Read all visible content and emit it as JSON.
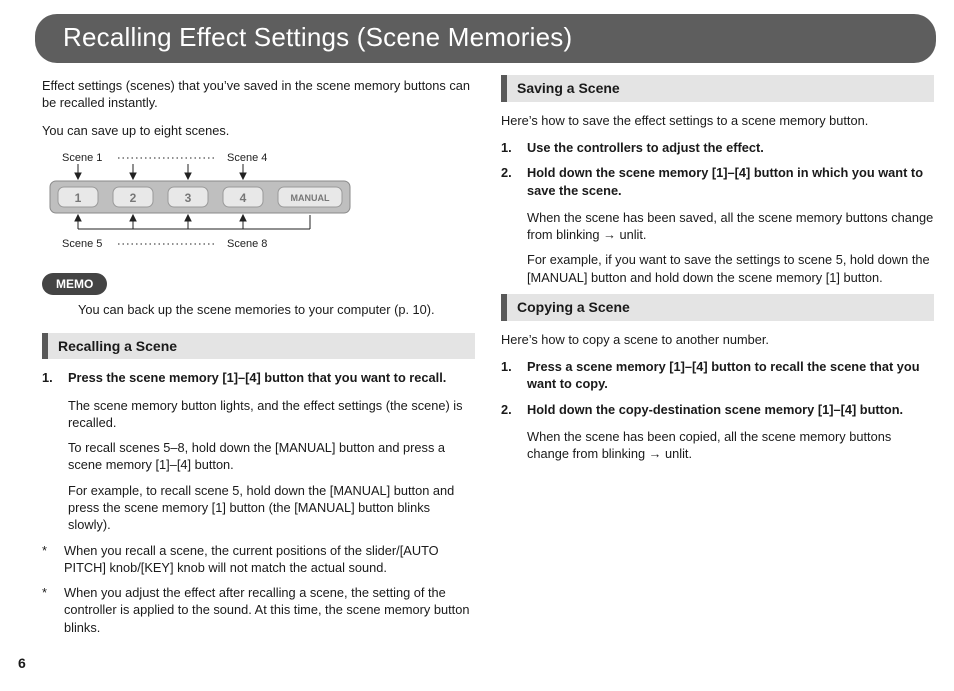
{
  "title": "Recalling Effect Settings (Scene Memories)",
  "page_number": "6",
  "left": {
    "intro1": "Effect settings (scenes) that you’ve saved in the scene memory buttons can be recalled instantly.",
    "intro2": "You can save up to eight scenes.",
    "diagram": {
      "scene1": "Scene 1",
      "scene4": "Scene 4",
      "scene5": "Scene 5",
      "scene8": "Scene 8",
      "btn1": "1",
      "btn2": "2",
      "btn3": "3",
      "btn4": "4",
      "manual": "MANUAL"
    },
    "memo_label": "MEMO",
    "memo_text": "You can back up the scene memories to your computer (p. 10).",
    "recall_head": "Recalling a Scene",
    "recall_step1": "Press the scene memory [1]–[4] button that you want to recall.",
    "recall_sub1": "The scene memory button lights, and the effect settings (the scene) is recalled.",
    "recall_sub2": "To recall scenes 5–8, hold down the [MANUAL] button and press a scene memory [1]–[4] button.",
    "recall_sub3": "For example, to recall scene 5, hold down the [MANUAL] button and press the scene memory [1] button (the [MANUAL] button blinks slowly).",
    "note1": "When you recall a scene, the current positions of the slider/[AUTO PITCH] knob/[KEY] knob will not match the actual sound.",
    "note2": "When you adjust the effect after recalling a scene, the setting of the controller is applied to the sound. At this time, the scene memory button blinks."
  },
  "right": {
    "save_head": "Saving a Scene",
    "save_intro": "Here’s how to save the effect settings to a scene memory button.",
    "save_step1": "Use the controllers to adjust the effect.",
    "save_step2": "Hold down the scene memory [1]–[4] button in which you want to save the scene.",
    "save_sub1a": "When the scene has been saved, all the scene memory buttons change from blinking ",
    "save_sub1b": " unlit.",
    "save_sub2": "For example, if you want to save the settings to scene 5, hold down the [MANUAL] button and hold down the scene memory [1] button.",
    "copy_head": "Copying a Scene",
    "copy_intro": "Here’s how to copy a scene to another number.",
    "copy_step1": "Press a scene memory [1]–[4] button to recall the scene that you want to copy.",
    "copy_step2": "Hold down the copy-destination scene memory [1]–[4] button.",
    "copy_sub1a": "When the scene has been copied, all the scene memory buttons change from blinking ",
    "copy_sub1b": " unlit.",
    "arrow": "→"
  }
}
